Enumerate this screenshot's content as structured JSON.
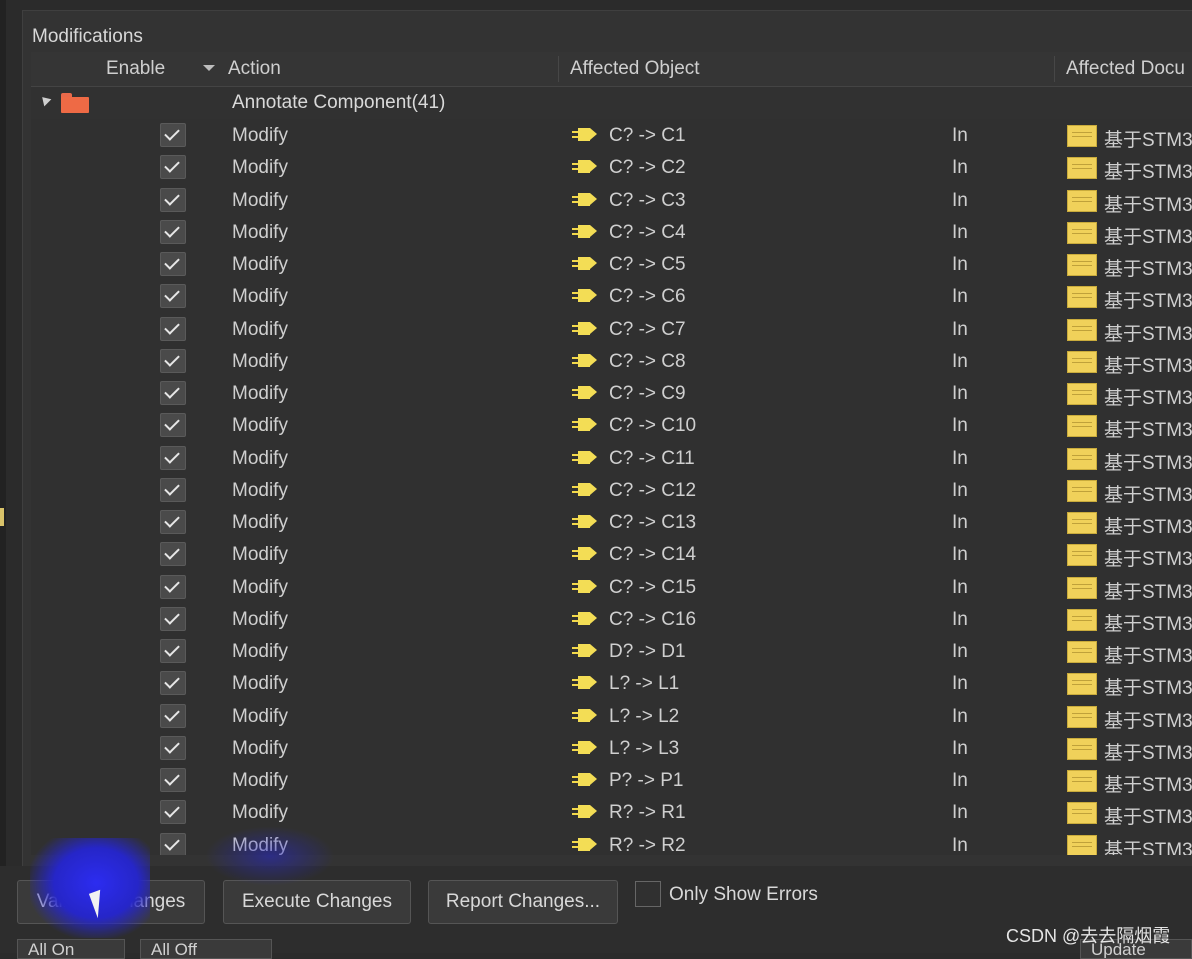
{
  "group_box": {
    "title": "Modifications"
  },
  "columns": {
    "enable": "Enable",
    "action": "Action",
    "affected_object": "Affected Object",
    "affected_document": "Affected Docu"
  },
  "group": {
    "label": "Annotate Component(41)"
  },
  "rows": [
    {
      "action": "Modify",
      "object": "C? -> C1",
      "direction": "In",
      "document": "基于STM3"
    },
    {
      "action": "Modify",
      "object": "C? -> C2",
      "direction": "In",
      "document": "基于STM3"
    },
    {
      "action": "Modify",
      "object": "C? -> C3",
      "direction": "In",
      "document": "基于STM3"
    },
    {
      "action": "Modify",
      "object": "C? -> C4",
      "direction": "In",
      "document": "基于STM3"
    },
    {
      "action": "Modify",
      "object": "C? -> C5",
      "direction": "In",
      "document": "基于STM3"
    },
    {
      "action": "Modify",
      "object": "C? -> C6",
      "direction": "In",
      "document": "基于STM3"
    },
    {
      "action": "Modify",
      "object": "C? -> C7",
      "direction": "In",
      "document": "基于STM3"
    },
    {
      "action": "Modify",
      "object": "C? -> C8",
      "direction": "In",
      "document": "基于STM3"
    },
    {
      "action": "Modify",
      "object": "C? -> C9",
      "direction": "In",
      "document": "基于STM3"
    },
    {
      "action": "Modify",
      "object": "C? -> C10",
      "direction": "In",
      "document": "基于STM3"
    },
    {
      "action": "Modify",
      "object": "C? -> C11",
      "direction": "In",
      "document": "基于STM3"
    },
    {
      "action": "Modify",
      "object": "C? -> C12",
      "direction": "In",
      "document": "基于STM3"
    },
    {
      "action": "Modify",
      "object": "C? -> C13",
      "direction": "In",
      "document": "基于STM3"
    },
    {
      "action": "Modify",
      "object": "C? -> C14",
      "direction": "In",
      "document": "基于STM3"
    },
    {
      "action": "Modify",
      "object": "C? -> C15",
      "direction": "In",
      "document": "基于STM3"
    },
    {
      "action": "Modify",
      "object": "C? -> C16",
      "direction": "In",
      "document": "基于STM3"
    },
    {
      "action": "Modify",
      "object": "D? -> D1",
      "direction": "In",
      "document": "基于STM3"
    },
    {
      "action": "Modify",
      "object": "L? -> L1",
      "direction": "In",
      "document": "基于STM3"
    },
    {
      "action": "Modify",
      "object": "L? -> L2",
      "direction": "In",
      "document": "基于STM3"
    },
    {
      "action": "Modify",
      "object": "L? -> L3",
      "direction": "In",
      "document": "基于STM3"
    },
    {
      "action": "Modify",
      "object": "P? -> P1",
      "direction": "In",
      "document": "基于STM3"
    },
    {
      "action": "Modify",
      "object": "R? -> R1",
      "direction": "In",
      "document": "基于STM3"
    },
    {
      "action": "Modify",
      "object": "R? -> R2",
      "direction": "In",
      "document": "基于STM3"
    }
  ],
  "buttons": {
    "validate": "Validate Changes",
    "execute": "Execute Changes",
    "report": "Report Changes..."
  },
  "options": {
    "only_show_errors": "Only Show Errors",
    "only_show_errors_checked": false
  },
  "bottom_tabs": {
    "all_on": "All On",
    "all_off": "All Off",
    "update": "Update Cha"
  },
  "watermark": "CSDN @去去隔烟霞",
  "colors": {
    "background": "#333333",
    "folder": "#ee6a45",
    "component_icon": "#f3dd55",
    "document_icon": "#f0d15a"
  }
}
